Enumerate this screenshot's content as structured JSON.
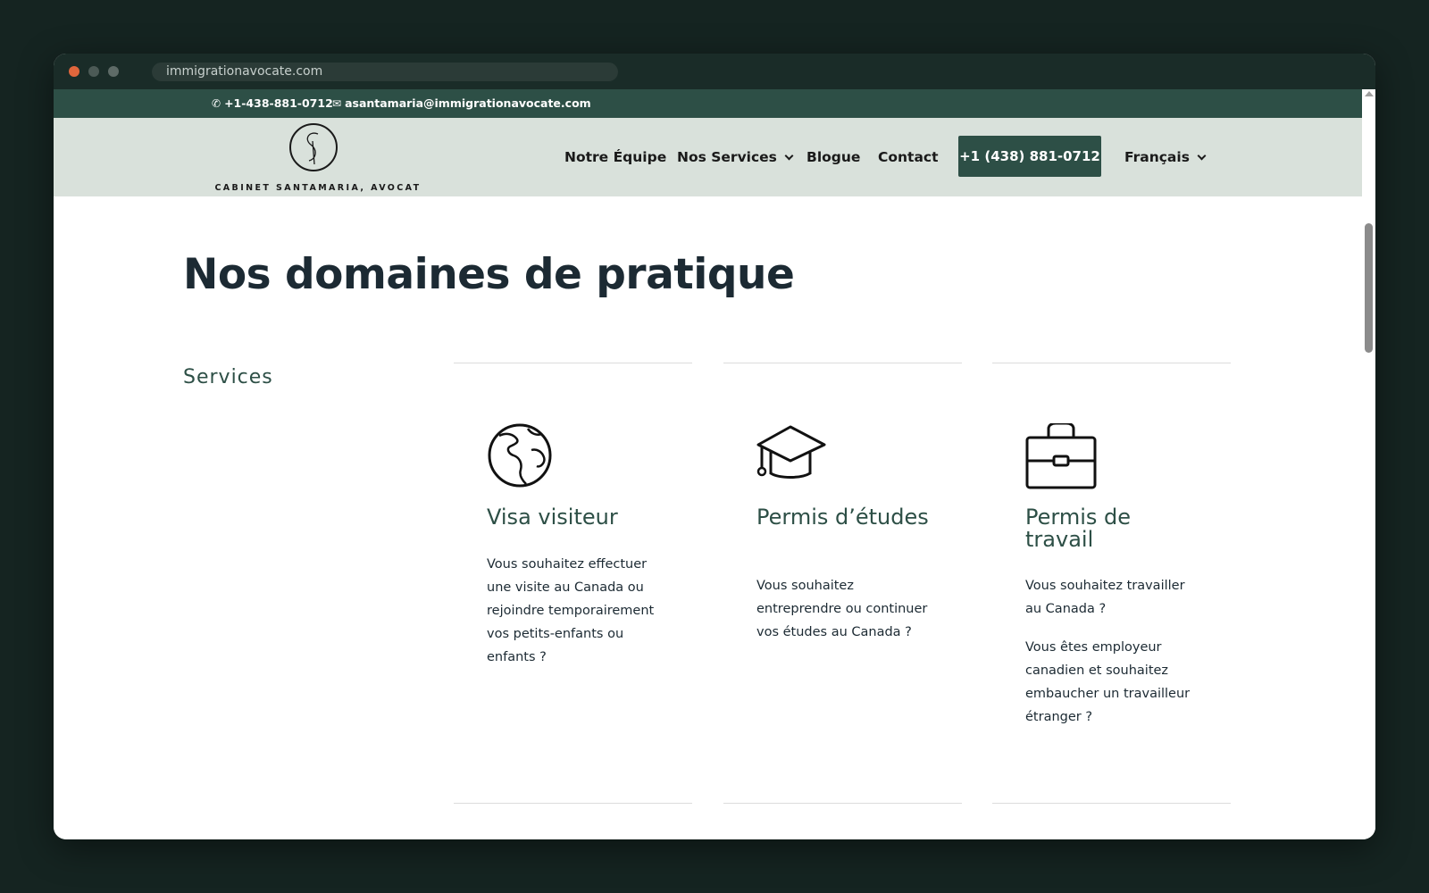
{
  "browser": {
    "url": "immigrationavocate.com"
  },
  "topbar": {
    "phone": "+1-438-881-0712",
    "email": "asantamaria@immigrationavocate.com",
    "phone_icon": "phone-icon",
    "email_icon": "envelope-icon"
  },
  "header": {
    "logo_text": "CABINET SANTAMARIA, AVOCAT",
    "nav": {
      "team": "Notre Équipe",
      "services": "Nos Services",
      "blog": "Blogue",
      "contact": "Contact",
      "cta": "+1 (438) 881-0712",
      "language": "Français"
    }
  },
  "main": {
    "title": "Nos domaines de pratique",
    "section_label": "Services",
    "cards": [
      {
        "icon": "globe-icon",
        "title": "Visa visiteur",
        "text": "Vous souhaitez effectuer une visite au Canada ou rejoindre temporairement vos petits-enfants ou enfants ?"
      },
      {
        "icon": "graduation-cap-icon",
        "title": "Permis d’études",
        "text": "Vous souhaitez entreprendre ou continuer vos études au Canada ?"
      },
      {
        "icon": "briefcase-icon",
        "title": "Permis de travail",
        "text": "Vous souhaitez travailler au Canada ?",
        "text2": "Vous êtes employeur canadien et souhaitez embaucher un travailleur étranger ?"
      }
    ]
  },
  "colors": {
    "brand_green": "#2d4f46",
    "header_bg": "#d9e1db",
    "outer_bg": "#152421",
    "title_text": "#1c2a33"
  }
}
